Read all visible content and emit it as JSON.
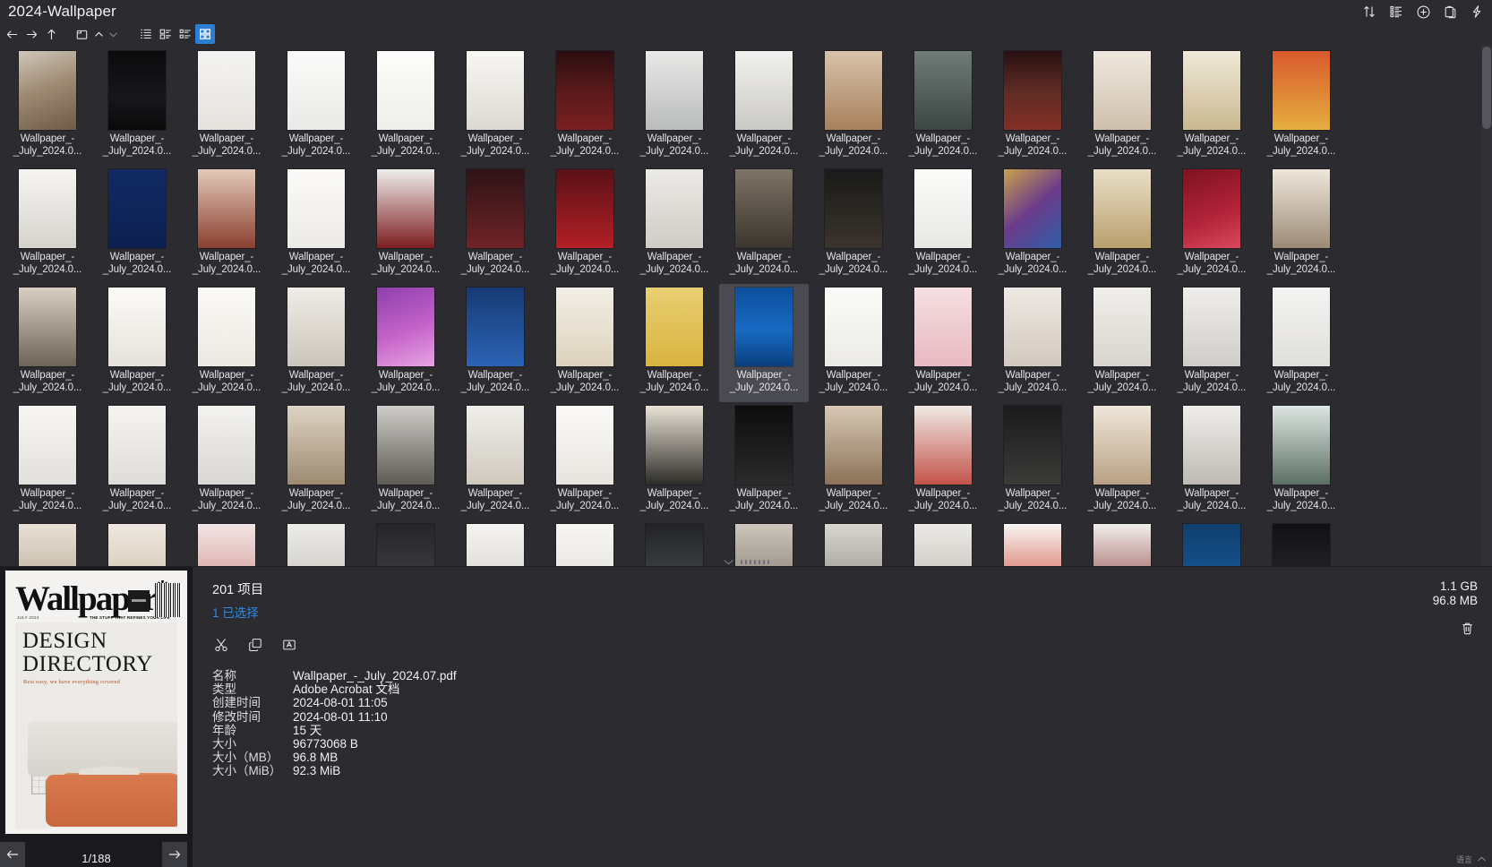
{
  "window": {
    "title": "2024-Wallpaper",
    "actions": [
      {
        "name": "sort-icon",
        "label": "Sort"
      },
      {
        "name": "list-details-icon",
        "label": "Details"
      },
      {
        "name": "plus-circle-icon",
        "label": "Add"
      },
      {
        "name": "clipboard-icon",
        "label": "Clipboard"
      },
      {
        "name": "lightning-icon",
        "label": "Quick Actions"
      }
    ]
  },
  "navbar": {
    "back": "←",
    "forward": "→",
    "up": "↑",
    "newfolder": "New Folder",
    "collapse_up": "^",
    "collapse_down": "v",
    "view_modes": [
      {
        "name": "view-list",
        "label": "List",
        "active": false
      },
      {
        "name": "view-details",
        "label": "Details",
        "active": false
      },
      {
        "name": "view-tiles",
        "label": "Tiles",
        "active": false
      },
      {
        "name": "view-icons",
        "label": "Icons",
        "active": true
      }
    ]
  },
  "grid": {
    "columns": 15,
    "label_line1": "Wallpaper_-",
    "label_line2": "_July_2024.0...",
    "selected_index": 38,
    "items": [
      {
        "i": 0,
        "bg": "linear-gradient(160deg,#cfc7bb 0%,#a08c74 45%,#6d5b47 100%)"
      },
      {
        "i": 1,
        "bg": "linear-gradient(180deg,#0b0b0c 0%,#16171a 60%,#0a0a0b 100%)"
      },
      {
        "i": 2,
        "bg": "linear-gradient(180deg,#f4f3f1 0%,#e6e3de 100%)"
      },
      {
        "i": 3,
        "bg": "linear-gradient(180deg,#fbfbfa 0%,#e9e9e7 100%)"
      },
      {
        "i": 4,
        "bg": "linear-gradient(180deg,#fdfdfc 0%,#efeeea 100%)"
      },
      {
        "i": 5,
        "bg": "linear-gradient(180deg,#f8f7f4 0%,#ddd9d2 100%)"
      },
      {
        "i": 6,
        "bg": "linear-gradient(180deg,#2b0e10 0%,#5d1a1c 55%,#791f1f 100%)"
      },
      {
        "i": 7,
        "bg": "linear-gradient(180deg,#e9e9e7 0%,#b9bcbb 100%)"
      },
      {
        "i": 8,
        "bg": "linear-gradient(180deg,#f2f1ef 0%,#c9c8c6 100%)"
      },
      {
        "i": 9,
        "bg": "linear-gradient(180deg,#d8c2aa 0%,#a7805c 100%)"
      },
      {
        "i": 10,
        "bg": "linear-gradient(180deg,#6f7c78 0%,#3c4643 100%)"
      },
      {
        "i": 11,
        "bg": "linear-gradient(180deg,#2a1012 0%,#5e2b24 50%,#832f25 100%)"
      },
      {
        "i": 12,
        "bg": "linear-gradient(180deg,#efe8de 0%,#cfc0ad 100%)"
      },
      {
        "i": 13,
        "bg": "linear-gradient(180deg,#f0e9d9 0%,#c9b88f 100%)"
      },
      {
        "i": 14,
        "bg": "linear-gradient(180deg,#d9592c 0%,#e4ad3f 100%)"
      },
      {
        "i": 15,
        "bg": "linear-gradient(180deg,#f6f5f3 0%,#d6d3cd 100%)"
      },
      {
        "i": 16,
        "bg": "linear-gradient(180deg,#112a63 0%,#0d2052 100%)"
      },
      {
        "i": 17,
        "bg": "linear-gradient(180deg,#e4c9b8 0%,#8a4030 100%)"
      },
      {
        "i": 18,
        "bg": "linear-gradient(180deg,#fbfaf8 0%,#eceae6 100%)"
      },
      {
        "i": 19,
        "bg": "linear-gradient(180deg,#efeeec 0%,#7d1d20 100%)"
      },
      {
        "i": 20,
        "bg": "linear-gradient(180deg,#2e1316 0%,#6f2327 100%)"
      },
      {
        "i": 21,
        "bg": "linear-gradient(180deg,#5a1116 0%,#b31f26 100%)"
      },
      {
        "i": 22,
        "bg": "linear-gradient(180deg,#eceae6 0%,#cfccc5 100%)"
      },
      {
        "i": 23,
        "bg": "linear-gradient(180deg,#7e7468 0%,#3b352d 100%)"
      },
      {
        "i": 24,
        "bg": "linear-gradient(180deg,#1a1a1a 0%,#3a352c 100%)"
      },
      {
        "i": 25,
        "bg": "linear-gradient(180deg,#fbfbfa 0%,#e8e7e4 100%)"
      },
      {
        "i": 26,
        "bg": "linear-gradient(140deg,#c9a24a 0%,#6c3b8a 50%,#2e5ea8 100%)"
      },
      {
        "i": 27,
        "bg": "linear-gradient(180deg,#e9dfc7 0%,#b99f6d 100%)"
      },
      {
        "i": 28,
        "bg": "linear-gradient(160deg,#7e1220 0%,#b4233a 60%,#d9495e 100%)"
      },
      {
        "i": 29,
        "bg": "linear-gradient(180deg,#efe7dc 0%,#9b8a75 100%)"
      },
      {
        "i": 30,
        "bg": "linear-gradient(180deg,#d9cfc2 0%,#6e6356 100%)"
      },
      {
        "i": 31,
        "bg": "linear-gradient(180deg,#fcfbf9 0%,#e6e2da 100%)"
      },
      {
        "i": 32,
        "bg": "linear-gradient(180deg,#fbfaf7 0%,#ece8e0 100%)"
      },
      {
        "i": 33,
        "bg": "linear-gradient(180deg,#efece6 0%,#cbc6bc 100%)"
      },
      {
        "i": 34,
        "bg": "linear-gradient(160deg,#8e3fae 0%,#c463c9 55%,#e7a4e2 100%)"
      },
      {
        "i": 35,
        "bg": "linear-gradient(180deg,#173a74 0%,#2b63b5 100%)"
      },
      {
        "i": 36,
        "bg": "linear-gradient(180deg,#f3efe6 0%,#ddd2bd 100%)"
      },
      {
        "i": 37,
        "bg": "linear-gradient(180deg,#e9cf72 0%,#d8b33f 100%)"
      },
      {
        "i": 38,
        "bg": "linear-gradient(180deg,#0d4f9c 0%,#1769c2 55%,#0b3f7f 100%)"
      },
      {
        "i": 39,
        "bg": "linear-gradient(180deg,#fbfbfa 0%,#ebeae7 100%)"
      },
      {
        "i": 40,
        "bg": "linear-gradient(180deg,#f6dfe2 0%,#e7b9c0 100%)"
      },
      {
        "i": 41,
        "bg": "linear-gradient(180deg,#efe9e3 0%,#d2c8bf 100%)"
      },
      {
        "i": 42,
        "bg": "linear-gradient(180deg,#f1efec 0%,#d8d4cd 100%)"
      },
      {
        "i": 43,
        "bg": "linear-gradient(180deg,#efeeec 0%,#cfcdc9 100%)"
      },
      {
        "i": 44,
        "bg": "linear-gradient(180deg,#f4f3f1 0%,#dfdedb 100%)"
      },
      {
        "i": 45,
        "bg": "linear-gradient(180deg,#f7f6f4 0%,#e2e0dc 100%)"
      },
      {
        "i": 46,
        "bg": "linear-gradient(180deg,#f5f4f2 0%,#dedcd8 100%)"
      },
      {
        "i": 47,
        "bg": "linear-gradient(180deg,#f3f2f0 0%,#d9d7d3 100%)"
      },
      {
        "i": 48,
        "bg": "linear-gradient(180deg,#ded4c4 0%,#9d8a71 100%)"
      },
      {
        "i": 49,
        "bg": "linear-gradient(180deg,#cfcdc9 0%,#5e5b55 100%)"
      },
      {
        "i": 50,
        "bg": "linear-gradient(180deg,#f0eeea 0%,#cfcabf 100%)"
      },
      {
        "i": 51,
        "bg": "linear-gradient(180deg,#fbfaf8 0%,#e7e4de 100%)"
      },
      {
        "i": 52,
        "bg": "linear-gradient(180deg,#e9e3d7 0%,#2e2c28 100%)"
      },
      {
        "i": 53,
        "bg": "linear-gradient(180deg,#0d0d0e 0%,#2a2a2b 100%)"
      },
      {
        "i": 54,
        "bg": "linear-gradient(180deg,#d7c8b5 0%,#8b7257 100%)"
      },
      {
        "i": 55,
        "bg": "linear-gradient(180deg,#efe9e4 0%,#c3534a 100%)"
      },
      {
        "i": 56,
        "bg": "linear-gradient(180deg,#1b1b1c 0%,#3b3a38 100%)"
      },
      {
        "i": 57,
        "bg": "linear-gradient(180deg,#efe6d9 0%,#b8a184 100%)"
      },
      {
        "i": 58,
        "bg": "linear-gradient(180deg,#f0eeec 0%,#bdb9b2 100%)"
      },
      {
        "i": 59,
        "bg": "linear-gradient(180deg,#dde6e2 0%,#5c6f64 100%)"
      },
      {
        "i": 60,
        "bg": "linear-gradient(180deg,#e8e1d6 0%,#b6a691 100%)"
      },
      {
        "i": 61,
        "bg": "linear-gradient(180deg,#efe9e1 0%,#cbbba6 100%)"
      },
      {
        "i": 62,
        "bg": "linear-gradient(180deg,#f2e6e4 0%,#cf8e8a 100%)"
      },
      {
        "i": 63,
        "bg": "linear-gradient(180deg,#ecebe8 0%,#c6c2bb 100%)"
      },
      {
        "i": 64,
        "bg": "linear-gradient(180deg,#25252a 0%,#45454a 100%)"
      },
      {
        "i": 65,
        "bg": "linear-gradient(180deg,#f4f3f1 0%,#d5d2cd 100%)"
      },
      {
        "i": 66,
        "bg": "linear-gradient(180deg,#f7f6f3 0%,#e0ddd7 100%)"
      },
      {
        "i": 67,
        "bg": "linear-gradient(180deg,#222428 0%,#4a4d52 100%)"
      },
      {
        "i": 68,
        "bg": "linear-gradient(180deg,#cdc6bc 0%,#7d7469 100%)"
      },
      {
        "i": 69,
        "bg": "linear-gradient(180deg,#d9d6d0 0%,#8e8a82 100%)"
      },
      {
        "i": 70,
        "bg": "linear-gradient(180deg,#eceae6 0%,#bcb8b1 100%)"
      },
      {
        "i": 71,
        "bg": "linear-gradient(180deg,#f6f5f2 0%,#d14b3a 100%)"
      },
      {
        "i": 72,
        "bg": "linear-gradient(180deg,#f0eeea 0%,#8c3f42 100%)"
      },
      {
        "i": 73,
        "bg": "linear-gradient(180deg,#0f3f6e 0%,#1b5f9e 100%)"
      },
      {
        "i": 74,
        "bg": "linear-gradient(180deg,#111114 0%,#2c2c30 100%)"
      }
    ]
  },
  "info": {
    "item_count": "201 项目",
    "selected_count": "1 已选择",
    "actions": [
      {
        "name": "cut-icon",
        "label": "剪切"
      },
      {
        "name": "copy-icon",
        "label": "复制"
      },
      {
        "name": "rename-icon",
        "label": "重命名"
      }
    ],
    "meta": [
      {
        "key": "名称",
        "value": "Wallpaper_-_July_2024.07.pdf"
      },
      {
        "key": "类型",
        "value": "Adobe Acrobat 文档"
      },
      {
        "key": "创建时间",
        "value": "2024-08-01  11:05"
      },
      {
        "key": "修改时间",
        "value": "2024-08-01  11:10"
      },
      {
        "key": "年龄",
        "value": "15 天"
      },
      {
        "key": "大小",
        "value": "96773068 B"
      },
      {
        "key": "大小（MB）",
        "value": "96.8 MB"
      },
      {
        "key": "大小（MiB）",
        "value": "92.3 MiB"
      }
    ],
    "total_size": "1.1 GB",
    "selected_size": "96.8 MB",
    "delete_label": "删除"
  },
  "preview": {
    "magazine_title": "Wallpaper",
    "magazine_star": "*",
    "cover_line1": "DESIGN",
    "cover_line2": "DIRECTORY",
    "cover_sub": "Rest easy, we have everything covered",
    "cover_date": "JULY 2024",
    "cover_tag": "THE STUFF THAT REFINES YOUR LIFE",
    "page_indicator": "1/188",
    "prev_label": "←",
    "next_label": "→"
  },
  "status": {
    "text": "语言"
  },
  "colors": {
    "background": "#2b2b30",
    "accent": "#2d7dd2",
    "link": "#2f8ae0",
    "selection": "#4a4a52",
    "text": "#f0f0f2"
  }
}
